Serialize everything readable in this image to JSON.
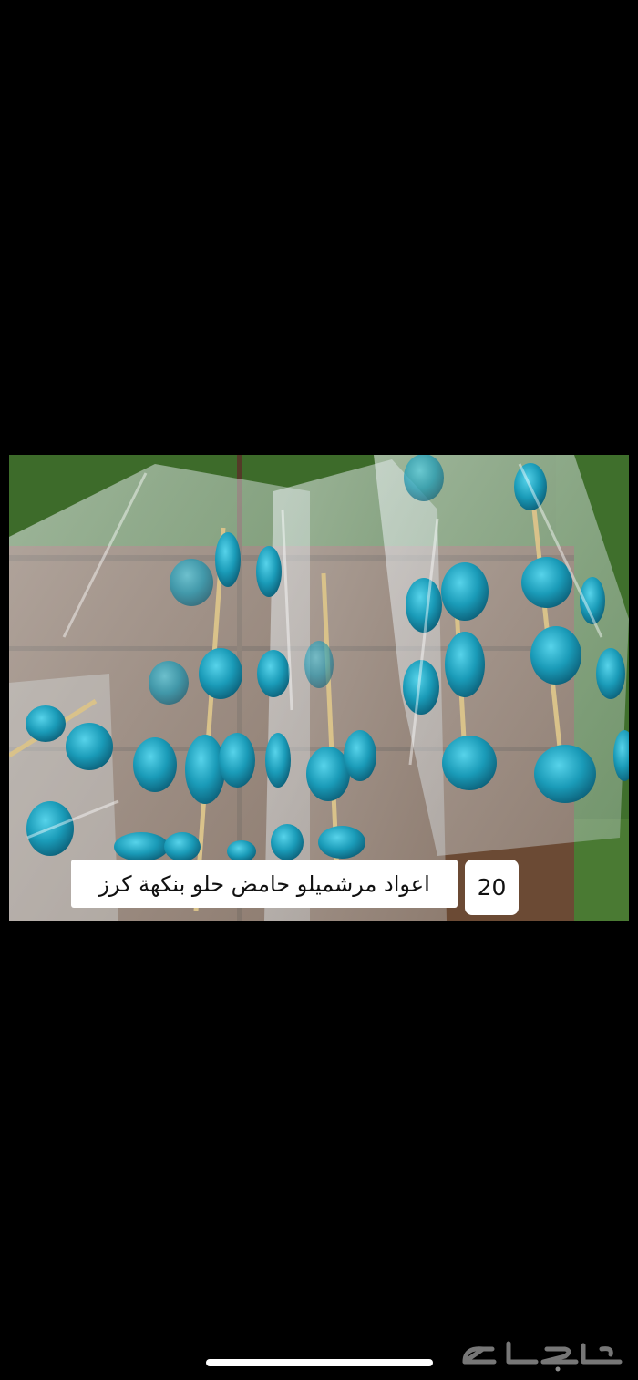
{
  "post": {
    "caption": "اعواد مرشميلو حامض حلو بنكهة كرز",
    "count": "20"
  },
  "watermark": {
    "text": "حراج"
  },
  "colors": {
    "background": "#000000",
    "marshmallow": "#1a9bb8",
    "grass": "#3d6b2a",
    "wood": "#6b4a34"
  }
}
